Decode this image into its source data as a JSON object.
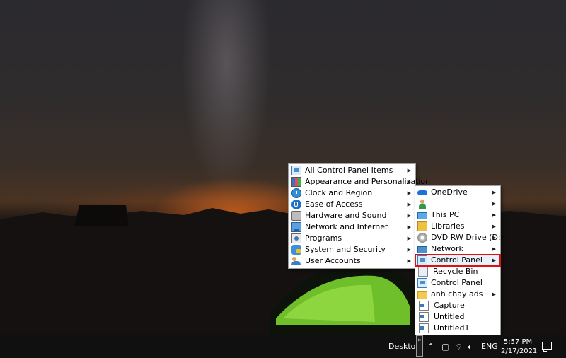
{
  "menu_main": {
    "items": [
      {
        "label": "All Control Panel Items",
        "icon": "control-panel-icon",
        "has_submenu": true
      },
      {
        "label": "Appearance and Personalization",
        "icon": "appearance-icon",
        "has_submenu": true
      },
      {
        "label": "Clock and Region",
        "icon": "clock-icon",
        "has_submenu": true
      },
      {
        "label": "Ease of Access",
        "icon": "ease-of-access-icon",
        "has_submenu": true
      },
      {
        "label": "Hardware and Sound",
        "icon": "hardware-icon",
        "has_submenu": true
      },
      {
        "label": "Network and Internet",
        "icon": "network-icon",
        "has_submenu": true
      },
      {
        "label": "Programs",
        "icon": "programs-icon",
        "has_submenu": true
      },
      {
        "label": "System and Security",
        "icon": "security-icon",
        "has_submenu": true
      },
      {
        "label": "User Accounts",
        "icon": "user-accounts-icon",
        "has_submenu": true
      }
    ]
  },
  "menu_desktop": {
    "items": [
      {
        "label": "OneDrive",
        "icon": "onedrive-icon",
        "has_submenu": true
      },
      {
        "label": "",
        "icon": "user-folder-icon",
        "has_submenu": true
      },
      {
        "label": "This PC",
        "icon": "this-pc-icon",
        "has_submenu": true
      },
      {
        "label": "Libraries",
        "icon": "libraries-icon",
        "has_submenu": true
      },
      {
        "label": "DVD RW Drive (D:)",
        "icon": "dvd-drive-icon",
        "has_submenu": true
      },
      {
        "label": "Network",
        "icon": "network-icon",
        "has_submenu": true
      },
      {
        "label": "Control Panel",
        "icon": "control-panel-icon",
        "has_submenu": true,
        "selected": true
      },
      {
        "label": "Recycle Bin",
        "icon": "recycle-bin-icon",
        "has_submenu": false
      },
      {
        "label": "Control Panel",
        "icon": "control-panel-icon",
        "has_submenu": false
      },
      {
        "label": "anh chay ads",
        "icon": "folder-icon",
        "has_submenu": true
      },
      {
        "label": "Capture",
        "icon": "file-icon",
        "has_submenu": false
      },
      {
        "label": "Untitled",
        "icon": "file-icon",
        "has_submenu": false
      },
      {
        "label": "Untitled1",
        "icon": "file-icon",
        "has_submenu": false
      }
    ]
  },
  "taskbar": {
    "toolbar_label": "Desktop",
    "expand_glyph": "»",
    "language": "ENG",
    "time": "5:57 PM",
    "date": "2/17/2021"
  },
  "colors": {
    "selection_outline": "#e01010",
    "taskbar": "#101010",
    "menu_bg": "#ffffff"
  }
}
